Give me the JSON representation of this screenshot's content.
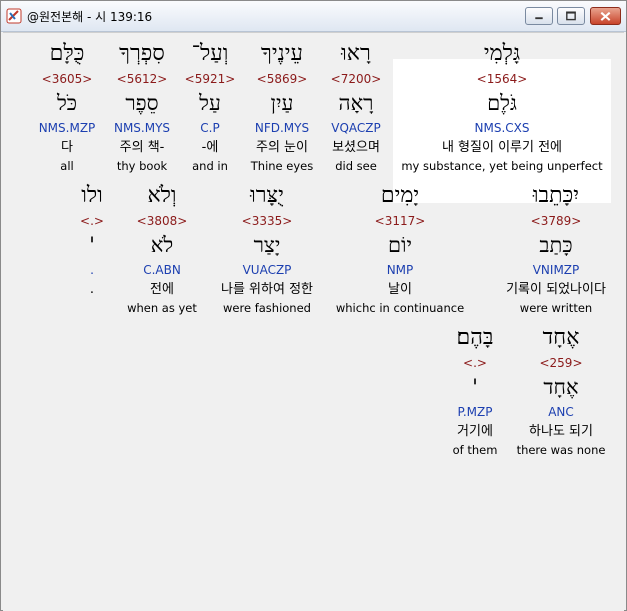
{
  "window": {
    "title": "@원전본해 - 시 139:16",
    "controls": [
      "minimize-icon",
      "maximize-icon",
      "close-icon"
    ]
  },
  "rows": [
    [
      {
        "heb": "גָּלְמִי",
        "num": "<1564>",
        "lemma": "גֹּלֶם",
        "parse": "NMS.CXS",
        "ko": "내 형질이 이루기 전에",
        "en": "my substance, yet  being unperfect"
      },
      {
        "heb": "רָאוּ",
        "num": "<7200>",
        "lemma": "רָאָה",
        "parse": "VQACZP",
        "ko": "보셨으며",
        "en": "did see"
      },
      {
        "heb": "עֵינֶיךָ",
        "num": "<5869>",
        "lemma": "עַיִן",
        "parse": "NFD.MYS",
        "ko": "주의 눈이",
        "en": "Thine eyes"
      },
      {
        "heb": "וְעַל־",
        "num": "<5921>",
        "lemma": "עַל",
        "parse": "C.P",
        "ko": "-에",
        "en": "and in"
      },
      {
        "heb": "סִפְרְךָ",
        "num": "<5612>",
        "lemma": "סֵפֶר",
        "parse": "NMS.MYS",
        "ko": "주의 책-",
        "en": "thy book"
      },
      {
        "heb": "כֻּלָּם",
        "num": "<3605>",
        "lemma": "כֹּל",
        "parse": "NMS.MZP",
        "ko": "다",
        "en": "all"
      }
    ],
    [
      {
        "heb": "יִכָּתֵבוּ",
        "num": "<3789>",
        "lemma": "כָּתַב",
        "parse": "VNIMZP",
        "ko": "기록이 되었나이다",
        "en": "were written"
      },
      {
        "heb": "יָמִים",
        "num": "<3117>",
        "lemma": "יוֹם",
        "parse": "NMP",
        "ko": "날이",
        "en": "whichc in continuance"
      },
      {
        "heb": "יֻצָּרוּ",
        "num": "<3335>",
        "lemma": "יָצַר",
        "parse": "VUACZP",
        "ko": "나를 위하여 정한",
        "en": "were fashioned"
      },
      {
        "heb": "וְלֹא",
        "num": "<3808>",
        "lemma": "לֹא",
        "parse": "C.ABN",
        "ko": "전에",
        "en": "when as yet"
      },
      {
        "heb": "ולו",
        "num": "<.>",
        "lemma": "'",
        "parse": ".",
        "ko": ".",
        "en": ""
      }
    ],
    [
      {
        "heb": "אֶחָד",
        "num": "<259>",
        "lemma": "אֶחָד",
        "parse": "ANC",
        "ko": "하나도 되기",
        "en": "there was none"
      },
      {
        "heb": "בָּהֶם׃",
        "num": "<.>",
        "lemma": "'",
        "parse": "P.MZP",
        "ko": "거기에",
        "en": "of them"
      }
    ]
  ]
}
